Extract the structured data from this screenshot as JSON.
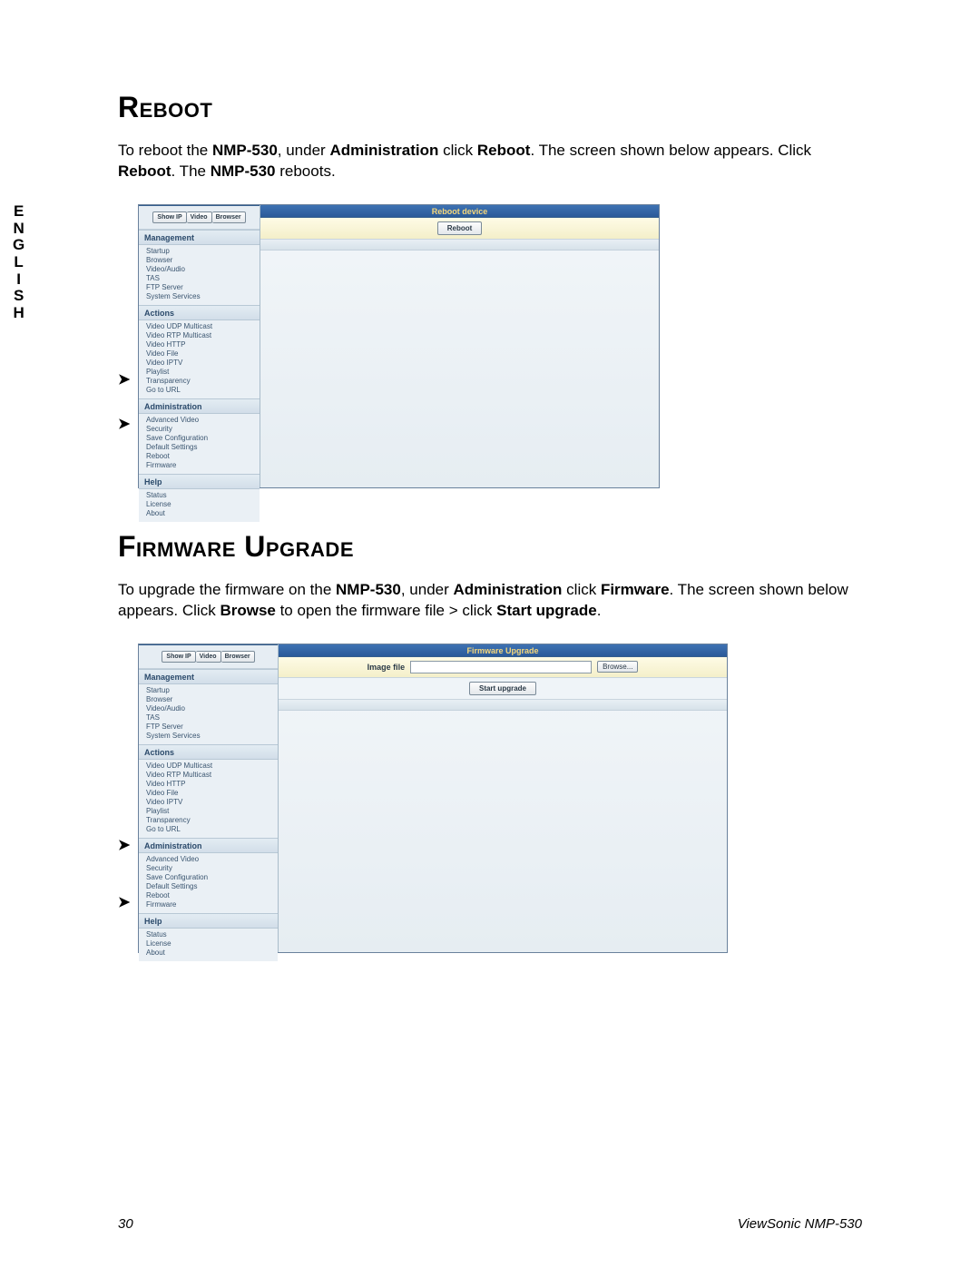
{
  "lang_tab": [
    "E",
    "N",
    "G",
    "L",
    "I",
    "S",
    "H"
  ],
  "sections": {
    "reboot": {
      "heading": "Reboot",
      "para": {
        "t1": "To reboot the ",
        "b1": "NMP-530",
        "t2": ", under ",
        "b2": "Administration",
        "t3": " click ",
        "b3": "Reboot",
        "t4": ". The screen shown below appears. Click ",
        "b4": "Reboot",
        "t5": ". The ",
        "b5": "NMP-530",
        "t6": " reboots."
      }
    },
    "firmware": {
      "heading": "Firmware Upgrade",
      "para": {
        "t1": "To upgrade the firmware on the ",
        "b1": "NMP-530",
        "t2": ", under ",
        "b2": "Administration",
        "t3": " click ",
        "b3": "Firmware",
        "t4": ". The screen shown below appears. Click ",
        "b4": "Browse",
        "t5": " to open the firmware file > click ",
        "b5": "Start upgrade",
        "t6": "."
      }
    }
  },
  "shot_common": {
    "btns": {
      "show_ip": "Show IP",
      "video": "Video",
      "browser": "Browser"
    },
    "sec_management": "Management",
    "management": [
      "Startup",
      "Browser",
      "Video/Audio",
      "TAS",
      "FTP Server",
      "System Services"
    ],
    "sec_actions": "Actions",
    "actions": [
      "Video UDP Multicast",
      "Video RTP Multicast",
      "Video HTTP",
      "Video File",
      "Video IPTV",
      "Playlist",
      "Transparency",
      "Go to URL"
    ],
    "sec_admin": "Administration",
    "admin": [
      "Advanced Video",
      "Security",
      "Save Configuration",
      "Default Settings",
      "Reboot",
      "Firmware"
    ],
    "sec_help": "Help",
    "help": [
      "Status",
      "License",
      "About"
    ]
  },
  "shot1": {
    "title": "Reboot device",
    "reboot_btn": "Reboot"
  },
  "shot2": {
    "title": "Firmware Upgrade",
    "img_label": "Image file",
    "browse_btn": "Browse...",
    "start_btn": "Start upgrade"
  },
  "footer": {
    "page": "30",
    "model": "ViewSonic NMP-530"
  }
}
